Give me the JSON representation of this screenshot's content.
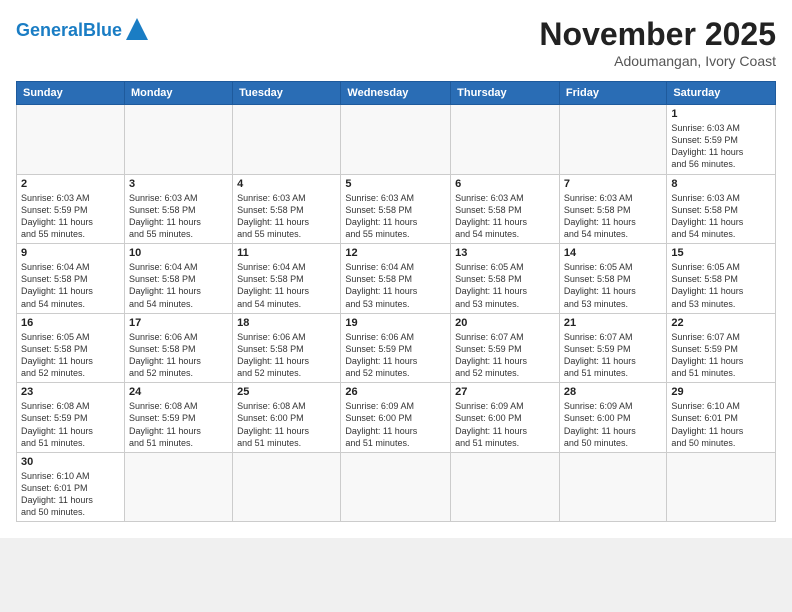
{
  "header": {
    "logo_general": "General",
    "logo_blue": "Blue",
    "month_title": "November 2025",
    "location": "Adoumangan, Ivory Coast"
  },
  "weekdays": [
    "Sunday",
    "Monday",
    "Tuesday",
    "Wednesday",
    "Thursday",
    "Friday",
    "Saturday"
  ],
  "weeks": [
    [
      {
        "day": "",
        "info": ""
      },
      {
        "day": "",
        "info": ""
      },
      {
        "day": "",
        "info": ""
      },
      {
        "day": "",
        "info": ""
      },
      {
        "day": "",
        "info": ""
      },
      {
        "day": "",
        "info": ""
      },
      {
        "day": "1",
        "info": "Sunrise: 6:03 AM\nSunset: 5:59 PM\nDaylight: 11 hours\nand 56 minutes."
      }
    ],
    [
      {
        "day": "2",
        "info": "Sunrise: 6:03 AM\nSunset: 5:59 PM\nDaylight: 11 hours\nand 55 minutes."
      },
      {
        "day": "3",
        "info": "Sunrise: 6:03 AM\nSunset: 5:58 PM\nDaylight: 11 hours\nand 55 minutes."
      },
      {
        "day": "4",
        "info": "Sunrise: 6:03 AM\nSunset: 5:58 PM\nDaylight: 11 hours\nand 55 minutes."
      },
      {
        "day": "5",
        "info": "Sunrise: 6:03 AM\nSunset: 5:58 PM\nDaylight: 11 hours\nand 55 minutes."
      },
      {
        "day": "6",
        "info": "Sunrise: 6:03 AM\nSunset: 5:58 PM\nDaylight: 11 hours\nand 54 minutes."
      },
      {
        "day": "7",
        "info": "Sunrise: 6:03 AM\nSunset: 5:58 PM\nDaylight: 11 hours\nand 54 minutes."
      },
      {
        "day": "8",
        "info": "Sunrise: 6:03 AM\nSunset: 5:58 PM\nDaylight: 11 hours\nand 54 minutes."
      }
    ],
    [
      {
        "day": "9",
        "info": "Sunrise: 6:04 AM\nSunset: 5:58 PM\nDaylight: 11 hours\nand 54 minutes."
      },
      {
        "day": "10",
        "info": "Sunrise: 6:04 AM\nSunset: 5:58 PM\nDaylight: 11 hours\nand 54 minutes."
      },
      {
        "day": "11",
        "info": "Sunrise: 6:04 AM\nSunset: 5:58 PM\nDaylight: 11 hours\nand 54 minutes."
      },
      {
        "day": "12",
        "info": "Sunrise: 6:04 AM\nSunset: 5:58 PM\nDaylight: 11 hours\nand 53 minutes."
      },
      {
        "day": "13",
        "info": "Sunrise: 6:05 AM\nSunset: 5:58 PM\nDaylight: 11 hours\nand 53 minutes."
      },
      {
        "day": "14",
        "info": "Sunrise: 6:05 AM\nSunset: 5:58 PM\nDaylight: 11 hours\nand 53 minutes."
      },
      {
        "day": "15",
        "info": "Sunrise: 6:05 AM\nSunset: 5:58 PM\nDaylight: 11 hours\nand 53 minutes."
      }
    ],
    [
      {
        "day": "16",
        "info": "Sunrise: 6:05 AM\nSunset: 5:58 PM\nDaylight: 11 hours\nand 52 minutes."
      },
      {
        "day": "17",
        "info": "Sunrise: 6:06 AM\nSunset: 5:58 PM\nDaylight: 11 hours\nand 52 minutes."
      },
      {
        "day": "18",
        "info": "Sunrise: 6:06 AM\nSunset: 5:58 PM\nDaylight: 11 hours\nand 52 minutes."
      },
      {
        "day": "19",
        "info": "Sunrise: 6:06 AM\nSunset: 5:59 PM\nDaylight: 11 hours\nand 52 minutes."
      },
      {
        "day": "20",
        "info": "Sunrise: 6:07 AM\nSunset: 5:59 PM\nDaylight: 11 hours\nand 52 minutes."
      },
      {
        "day": "21",
        "info": "Sunrise: 6:07 AM\nSunset: 5:59 PM\nDaylight: 11 hours\nand 51 minutes."
      },
      {
        "day": "22",
        "info": "Sunrise: 6:07 AM\nSunset: 5:59 PM\nDaylight: 11 hours\nand 51 minutes."
      }
    ],
    [
      {
        "day": "23",
        "info": "Sunrise: 6:08 AM\nSunset: 5:59 PM\nDaylight: 11 hours\nand 51 minutes."
      },
      {
        "day": "24",
        "info": "Sunrise: 6:08 AM\nSunset: 5:59 PM\nDaylight: 11 hours\nand 51 minutes."
      },
      {
        "day": "25",
        "info": "Sunrise: 6:08 AM\nSunset: 6:00 PM\nDaylight: 11 hours\nand 51 minutes."
      },
      {
        "day": "26",
        "info": "Sunrise: 6:09 AM\nSunset: 6:00 PM\nDaylight: 11 hours\nand 51 minutes."
      },
      {
        "day": "27",
        "info": "Sunrise: 6:09 AM\nSunset: 6:00 PM\nDaylight: 11 hours\nand 51 minutes."
      },
      {
        "day": "28",
        "info": "Sunrise: 6:09 AM\nSunset: 6:00 PM\nDaylight: 11 hours\nand 50 minutes."
      },
      {
        "day": "29",
        "info": "Sunrise: 6:10 AM\nSunset: 6:01 PM\nDaylight: 11 hours\nand 50 minutes."
      }
    ],
    [
      {
        "day": "30",
        "info": "Sunrise: 6:10 AM\nSunset: 6:01 PM\nDaylight: 11 hours\nand 50 minutes."
      },
      {
        "day": "",
        "info": ""
      },
      {
        "day": "",
        "info": ""
      },
      {
        "day": "",
        "info": ""
      },
      {
        "day": "",
        "info": ""
      },
      {
        "day": "",
        "info": ""
      },
      {
        "day": "",
        "info": ""
      }
    ]
  ]
}
